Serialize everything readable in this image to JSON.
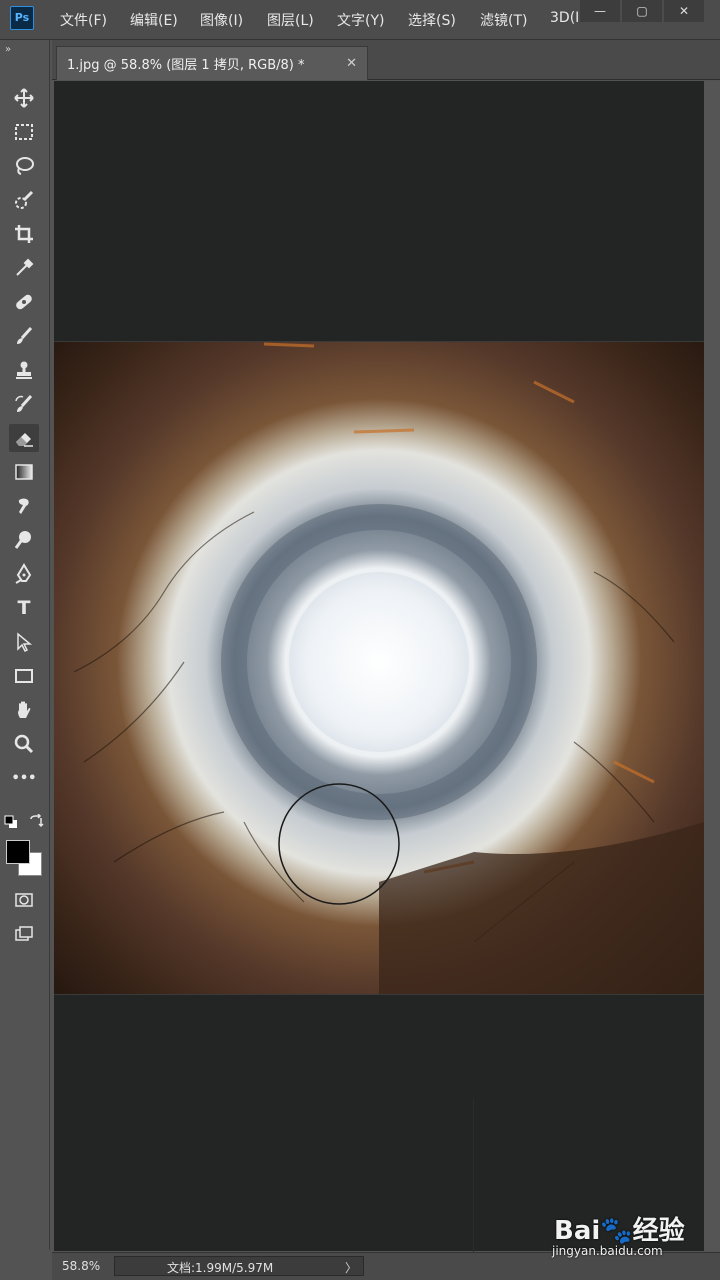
{
  "app": {
    "logo_text": "Ps"
  },
  "menu": {
    "items": [
      "文件(F)",
      "编辑(E)",
      "图像(I)",
      "图层(L)",
      "文字(Y)",
      "选择(S)",
      "滤镜(T)",
      "3D(I"
    ]
  },
  "window_controls": {
    "minimize": "—",
    "maximize": "▢",
    "close": "✕"
  },
  "toolbox": {
    "collapse_glyph": "»",
    "active_tool": "eraser-tool",
    "text_tool_glyph": "T",
    "more_glyph": "•••"
  },
  "document_tab": {
    "title": "1.jpg @ 58.8% (图层 1 拷贝, RGB/8) *",
    "close_glyph": "✕"
  },
  "status": {
    "zoom": "58.8%",
    "doc_size": "文档:1.99M/5.97M",
    "arrow": "〉"
  },
  "colors": {
    "foreground": "#000000",
    "background": "#ffffff",
    "ps_accent": "#2f8ee0"
  },
  "watermark": {
    "logo": "Bai🐾经验",
    "url": "jingyan.baidu.com"
  }
}
